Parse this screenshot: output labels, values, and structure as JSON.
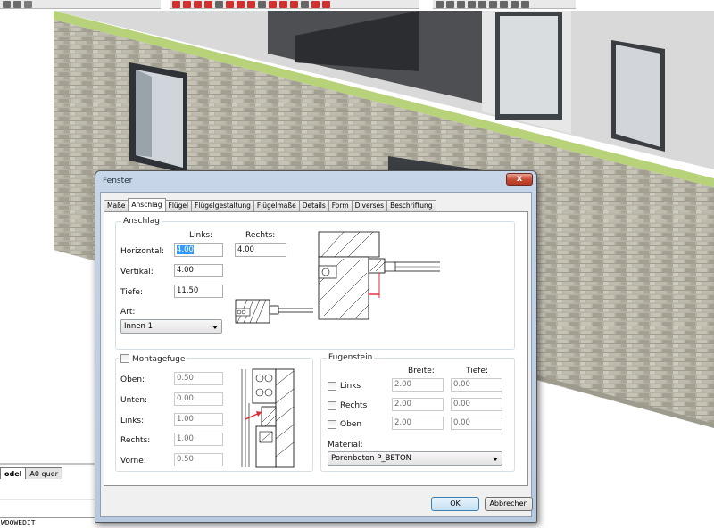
{
  "dialog": {
    "title": "Fenster",
    "close_glyph": "x",
    "tabs": [
      "Maße",
      "Anschlag",
      "Flügel",
      "Flügelgestaltung",
      "Flügelmaße",
      "Details",
      "Form",
      "Diverses",
      "Beschriftung"
    ],
    "active_tab": "Anschlag",
    "anschlag": {
      "group_title": "Anschlag",
      "col_links": "Links:",
      "col_rechts": "Rechts:",
      "horizontal_label": "Horizontal:",
      "horizontal_links": "4.00",
      "horizontal_rechts": "4.00",
      "vertikal_label": "Vertikal:",
      "vertikal_links": "4.00",
      "tiefe_label": "Tiefe:",
      "tiefe_links": "11.50",
      "art_label": "Art:",
      "art_value": "Innen 1"
    },
    "montagefuge": {
      "title": "Montagefuge",
      "checked": false,
      "oben_label": "Oben:",
      "oben_value": "0.50",
      "unten_label": "Unten:",
      "unten_value": "0.00",
      "links_label": "Links:",
      "links_value": "1.00",
      "rechts_label": "Rechts:",
      "rechts_value": "1.00",
      "vorne_label": "Vorne:",
      "vorne_value": "0.50"
    },
    "fugenstein": {
      "title": "Fugenstein",
      "col_breite": "Breite:",
      "col_tiefe": "Tiefe:",
      "rows": [
        {
          "label": "Links",
          "breite": "2.00",
          "tiefe": "0.00",
          "checked": false
        },
        {
          "label": "Rechts",
          "breite": "2.00",
          "tiefe": "0.00",
          "checked": false
        },
        {
          "label": "Oben",
          "breite": "2.00",
          "tiefe": "0.00",
          "checked": false
        }
      ],
      "material_label": "Material:",
      "material_value": "Porenbeton P_BETON"
    },
    "ok_label": "OK",
    "cancel_label": "Abbrechen"
  },
  "cad": {
    "layout_tabs": [
      "odel",
      "A0 quer"
    ],
    "command_line": "WDOWEDIT",
    "colors": {
      "brick": "#b9b6a8",
      "roof_band": "#b8d27a",
      "window_frame": "#3b3f45",
      "glass": "#cfd6dc",
      "dialog_frame": "#bfd0e4",
      "dimension_red": "#e0262e"
    }
  }
}
